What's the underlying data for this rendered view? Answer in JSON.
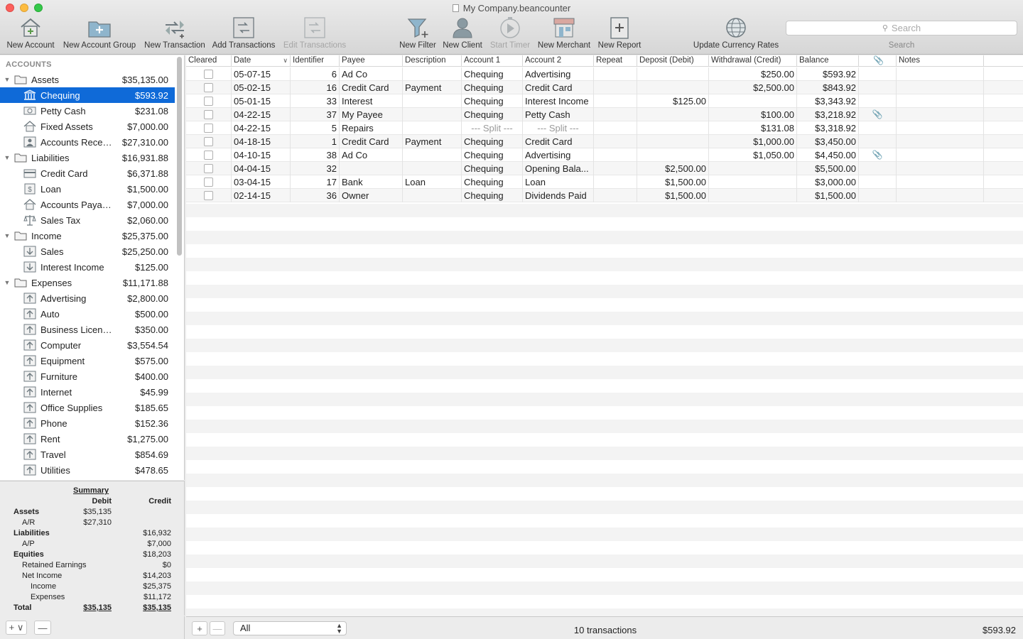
{
  "window": {
    "title": "My Company.beancounter"
  },
  "toolbar": {
    "buttons": [
      {
        "label": "New Account",
        "icon": "house-add-icon",
        "enabled": true
      },
      {
        "label": "New Account Group",
        "icon": "folder-add-icon",
        "enabled": true
      },
      {
        "label": "New Transaction",
        "icon": "transfer-arrows-icon",
        "enabled": true
      },
      {
        "label": "Add Transactions",
        "icon": "transactions-stack-icon",
        "enabled": true
      },
      {
        "label": "Edit Transactions",
        "icon": "edit-transactions-icon",
        "enabled": false
      },
      {
        "label": "New Filter",
        "icon": "funnel-icon",
        "enabled": true
      },
      {
        "label": "New Client",
        "icon": "person-icon",
        "enabled": true
      },
      {
        "label": "Start Timer",
        "icon": "timer-play-icon",
        "enabled": false
      },
      {
        "label": "New Merchant",
        "icon": "storefront-icon",
        "enabled": true
      },
      {
        "label": "New Report",
        "icon": "report-add-icon",
        "enabled": true
      },
      {
        "label": "Update Currency Rates",
        "icon": "globe-icon",
        "enabled": true
      }
    ],
    "search": {
      "placeholder": "Search",
      "caption": "Search"
    }
  },
  "sidebar": {
    "header": "ACCOUNTS",
    "accounts": [
      {
        "name": "Assets",
        "balance": "$35,135.00",
        "level": 0,
        "icon": "folder-icon",
        "expanded": true
      },
      {
        "name": "Chequing",
        "balance": "$593.92",
        "level": 1,
        "icon": "bank-icon",
        "selected": true
      },
      {
        "name": "Petty Cash",
        "balance": "$231.08",
        "level": 1,
        "icon": "cash-icon"
      },
      {
        "name": "Fixed Assets",
        "balance": "$7,000.00",
        "level": 1,
        "icon": "house-icon"
      },
      {
        "name": "Accounts Receiv...",
        "balance": "$27,310.00",
        "level": 1,
        "icon": "person-account-icon"
      },
      {
        "name": "Liabilities",
        "balance": "$16,931.88",
        "level": 0,
        "icon": "folder-icon",
        "expanded": true
      },
      {
        "name": "Credit Card",
        "balance": "$6,371.88",
        "level": 1,
        "icon": "credit-card-icon"
      },
      {
        "name": "Loan",
        "balance": "$1,500.00",
        "level": 1,
        "icon": "dollar-doc-icon"
      },
      {
        "name": "Accounts Payable",
        "balance": "$7,000.00",
        "level": 1,
        "icon": "house-icon"
      },
      {
        "name": "Sales Tax",
        "balance": "$2,060.00",
        "level": 1,
        "icon": "scales-icon"
      },
      {
        "name": "Income",
        "balance": "$25,375.00",
        "level": 0,
        "icon": "folder-icon",
        "expanded": true
      },
      {
        "name": "Sales",
        "balance": "$25,250.00",
        "level": 1,
        "icon": "income-arrow-icon"
      },
      {
        "name": "Interest Income",
        "balance": "$125.00",
        "level": 1,
        "icon": "income-arrow-icon"
      },
      {
        "name": "Expenses",
        "balance": "$11,171.88",
        "level": 0,
        "icon": "folder-icon",
        "expanded": true
      },
      {
        "name": "Advertising",
        "balance": "$2,800.00",
        "level": 1,
        "icon": "expense-arrow-icon"
      },
      {
        "name": "Auto",
        "balance": "$500.00",
        "level": 1,
        "icon": "expense-arrow-icon"
      },
      {
        "name": "Business Licenses/...",
        "balance": "$350.00",
        "level": 1,
        "icon": "expense-arrow-icon"
      },
      {
        "name": "Computer",
        "balance": "$3,554.54",
        "level": 1,
        "icon": "expense-arrow-icon"
      },
      {
        "name": "Equipment",
        "balance": "$575.00",
        "level": 1,
        "icon": "expense-arrow-icon"
      },
      {
        "name": "Furniture",
        "balance": "$400.00",
        "level": 1,
        "icon": "expense-arrow-icon"
      },
      {
        "name": "Internet",
        "balance": "$45.99",
        "level": 1,
        "icon": "expense-arrow-icon"
      },
      {
        "name": "Office Supplies",
        "balance": "$185.65",
        "level": 1,
        "icon": "expense-arrow-icon"
      },
      {
        "name": "Phone",
        "balance": "$152.36",
        "level": 1,
        "icon": "expense-arrow-icon"
      },
      {
        "name": "Rent",
        "balance": "$1,275.00",
        "level": 1,
        "icon": "expense-arrow-icon"
      },
      {
        "name": "Travel",
        "balance": "$854.69",
        "level": 1,
        "icon": "expense-arrow-icon"
      },
      {
        "name": "Utilities",
        "balance": "$478.65",
        "level": 1,
        "icon": "expense-arrow-icon"
      }
    ]
  },
  "summary": {
    "title": "Summary",
    "debit_header": "Debit",
    "credit_header": "Credit",
    "rows": [
      {
        "label": "Assets",
        "debit": "$35,135",
        "credit": "",
        "indent": 0,
        "bold": true
      },
      {
        "label": "A/R",
        "debit": "$27,310",
        "credit": "",
        "indent": 1
      },
      {
        "label": "Liabilities",
        "debit": "",
        "credit": "$16,932",
        "indent": 0,
        "bold": true
      },
      {
        "label": "A/P",
        "debit": "",
        "credit": "$7,000",
        "indent": 1
      },
      {
        "label": "Equities",
        "debit": "",
        "credit": "$18,203",
        "indent": 0,
        "bold": true
      },
      {
        "label": "Retained Earnings",
        "debit": "",
        "credit": "$0",
        "indent": 1
      },
      {
        "label": "Net Income",
        "debit": "",
        "credit": "$14,203",
        "indent": 1
      },
      {
        "label": "Income",
        "debit": "",
        "credit": "$25,375",
        "indent": 2
      },
      {
        "label": "Expenses",
        "debit": "",
        "credit": "$11,172",
        "indent": 2
      },
      {
        "label": "Total",
        "debit": "$35,135",
        "credit": "$35,135",
        "indent": 0,
        "bold": true,
        "underline": true
      }
    ]
  },
  "sidebar_footer": {
    "add_label": "+ ∨",
    "remove_label": "—"
  },
  "table": {
    "columns": [
      "Cleared",
      "Date",
      "Identifier",
      "Payee",
      "Description",
      "Account 1",
      "Account 2",
      "Repeat",
      "Deposit (Debit)",
      "Withdrawal (Credit)",
      "Balance",
      "",
      "Notes"
    ],
    "rows": [
      {
        "cleared": false,
        "date": "05-07-15",
        "id": "6",
        "payee": "Ad Co",
        "desc": "",
        "acct1": "Chequing",
        "acct2": "Advertising",
        "repeat": "",
        "deposit": "",
        "withdrawal": "$250.00",
        "balance": "$593.92",
        "attach": false,
        "notes": ""
      },
      {
        "cleared": false,
        "date": "05-02-15",
        "id": "16",
        "payee": "Credit Card",
        "desc": "Payment",
        "acct1": "Chequing",
        "acct2": "Credit Card",
        "repeat": "",
        "deposit": "",
        "withdrawal": "$2,500.00",
        "balance": "$843.92",
        "attach": false,
        "notes": ""
      },
      {
        "cleared": false,
        "date": "05-01-15",
        "id": "33",
        "payee": "Interest",
        "desc": "",
        "acct1": "Chequing",
        "acct2": "Interest Income",
        "repeat": "",
        "deposit": "$125.00",
        "withdrawal": "",
        "balance": "$3,343.92",
        "attach": false,
        "notes": ""
      },
      {
        "cleared": false,
        "date": "04-22-15",
        "id": "37",
        "payee": "My Payee",
        "desc": "",
        "acct1": "Chequing",
        "acct2": "Petty Cash",
        "repeat": "",
        "deposit": "",
        "withdrawal": "$100.00",
        "balance": "$3,218.92",
        "attach": true,
        "notes": ""
      },
      {
        "cleared": false,
        "date": "04-22-15",
        "id": "5",
        "payee": "Repairs",
        "desc": "",
        "acct1": "--- Split ---",
        "acct2": "--- Split ---",
        "split": true,
        "repeat": "",
        "deposit": "",
        "withdrawal": "$131.08",
        "balance": "$3,318.92",
        "attach": false,
        "notes": ""
      },
      {
        "cleared": false,
        "date": "04-18-15",
        "id": "1",
        "payee": "Credit Card",
        "desc": "Payment",
        "acct1": "Chequing",
        "acct2": "Credit Card",
        "repeat": "",
        "deposit": "",
        "withdrawal": "$1,000.00",
        "balance": "$3,450.00",
        "attach": false,
        "notes": ""
      },
      {
        "cleared": false,
        "date": "04-10-15",
        "id": "38",
        "payee": "Ad Co",
        "desc": "",
        "acct1": "Chequing",
        "acct2": "Advertising",
        "repeat": "",
        "deposit": "",
        "withdrawal": "$1,050.00",
        "balance": "$4,450.00",
        "attach": true,
        "notes": ""
      },
      {
        "cleared": false,
        "date": "04-04-15",
        "id": "32",
        "payee": "",
        "desc": "",
        "acct1": "Chequing",
        "acct2": "Opening Bala...",
        "repeat": "",
        "deposit": "$2,500.00",
        "withdrawal": "",
        "balance": "$5,500.00",
        "attach": false,
        "notes": ""
      },
      {
        "cleared": false,
        "date": "03-04-15",
        "id": "17",
        "payee": "Bank",
        "desc": "Loan",
        "acct1": "Chequing",
        "acct2": "Loan",
        "repeat": "",
        "deposit": "$1,500.00",
        "withdrawal": "",
        "balance": "$3,000.00",
        "attach": false,
        "notes": ""
      },
      {
        "cleared": false,
        "date": "02-14-15",
        "id": "36",
        "payee": "Owner",
        "desc": "",
        "acct1": "Chequing",
        "acct2": "Dividends Paid",
        "repeat": "",
        "deposit": "$1,500.00",
        "withdrawal": "",
        "balance": "$1,500.00",
        "attach": false,
        "notes": ""
      }
    ]
  },
  "bottom_bar": {
    "add_label": "+",
    "remove_label": "—",
    "filter_value": "All",
    "transaction_count": "10 transactions",
    "balance": "$593.92"
  },
  "colors": {
    "selection": "#0f6ad8",
    "icon_stroke": "#6f7a80",
    "icon_fill": "#8fb5cc"
  }
}
